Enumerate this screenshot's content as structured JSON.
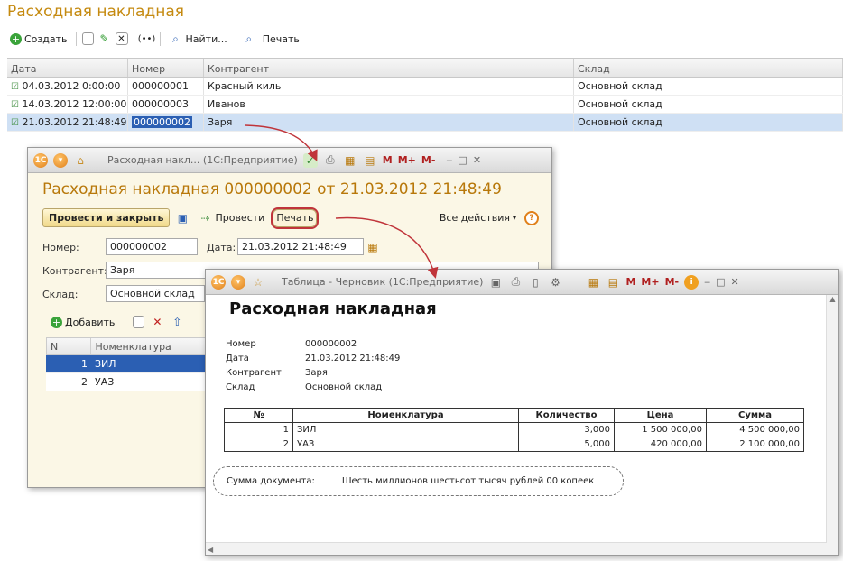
{
  "main": {
    "title": "Расходная накладная",
    "toolbar": {
      "create_label": "Создать",
      "find_label": "Найти...",
      "print_label": "Печать"
    },
    "columns": [
      "Дата",
      "Номер",
      "Контрагент",
      "Склад"
    ],
    "rows": [
      {
        "date": "04.03.2012 0:00:00",
        "number": "000000001",
        "counterparty": "Красный киль",
        "warehouse": "Основной склад"
      },
      {
        "date": "14.03.2012 12:00:00",
        "number": "000000003",
        "counterparty": "Иванов",
        "warehouse": "Основной склад"
      },
      {
        "date": "21.03.2012 21:48:49",
        "number": "000000002",
        "counterparty": "Заря",
        "warehouse": "Основной склад"
      }
    ]
  },
  "form": {
    "window_title": "Расходная накл... (1С:Предприятие)",
    "title": "Расходная накладная 000000002 от 21.03.2012 21:48:49",
    "post_close_label": "Провести и закрыть",
    "post_label": "Провести",
    "print_label": "Печать",
    "all_actions_label": "Все действия",
    "number_label": "Номер:",
    "number_value": "000000002",
    "date_label": "Дата:",
    "date_value": "21.03.2012 21:48:49",
    "counterparty_label": "Контрагент:",
    "counterparty_value": "Заря",
    "warehouse_label": "Склад:",
    "warehouse_value": "Основной склад",
    "add_label": "Добавить",
    "columns": [
      "N",
      "Номенклатура"
    ],
    "rows": [
      {
        "n": "1",
        "item": "ЗИЛ"
      },
      {
        "n": "2",
        "item": "УАЗ"
      }
    ]
  },
  "print": {
    "window_title": "Таблица - Черновик (1С:Предприятие)",
    "doc_title": "Расходная накладная",
    "fields": [
      {
        "label": "Номер",
        "value": "000000002"
      },
      {
        "label": "Дата",
        "value": "21.03.2012 21:48:49"
      },
      {
        "label": "Контрагент",
        "value": "Заря"
      },
      {
        "label": "Склад",
        "value": "Основной склад"
      }
    ],
    "columns": [
      "№",
      "Номенклатура",
      "Количество",
      "Цена",
      "Сумма"
    ],
    "rows": [
      {
        "n": "1",
        "item": "ЗИЛ",
        "qty": "3,000",
        "price": "1 500 000,00",
        "sum": "4 500 000,00"
      },
      {
        "n": "2",
        "item": "УАЗ",
        "qty": "5,000",
        "price": "420 000,00",
        "sum": "2 100 000,00"
      }
    ],
    "sum_label": "Сумма документа:",
    "sum_words": "Шесть миллионов шестьсот тысяч рублей 00 копеек"
  },
  "colors": {
    "accent": "#c58a10",
    "selection": "#cfe0f4",
    "arrow": "#c0343a"
  }
}
